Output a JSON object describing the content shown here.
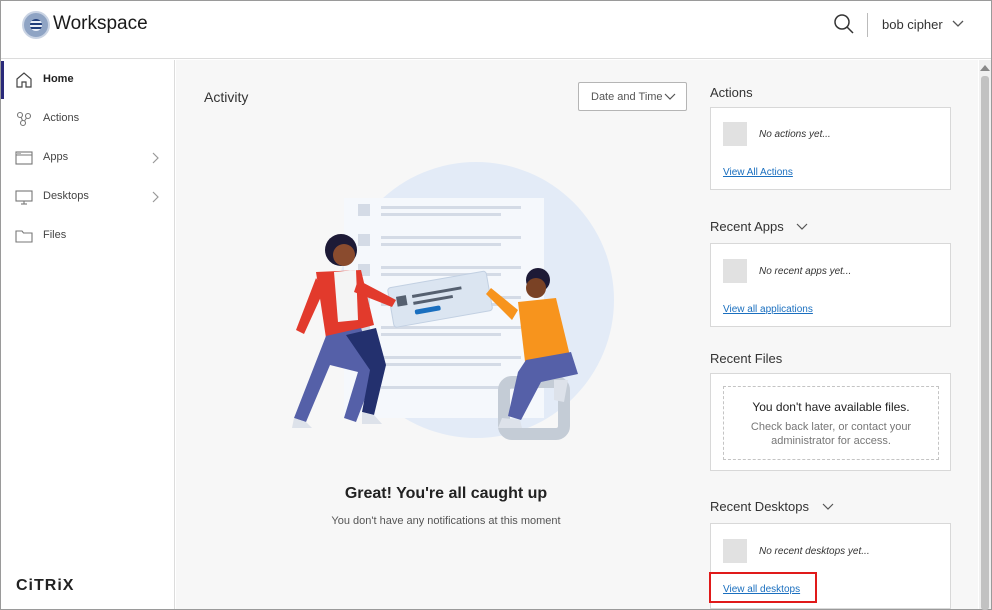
{
  "header": {
    "app_title": "Workspace",
    "search_icon": "search-icon",
    "user_name": "bob cipher"
  },
  "sidebar": {
    "items": [
      {
        "label": "Home",
        "icon": "home-icon",
        "active": true
      },
      {
        "label": "Actions",
        "icon": "actions-icon"
      },
      {
        "label": "Apps",
        "icon": "apps-icon",
        "has_submenu": true
      },
      {
        "label": "Desktops",
        "icon": "desktop-icon",
        "has_submenu": true
      },
      {
        "label": "Files",
        "icon": "folder-icon"
      }
    ],
    "brand": "CiTRiX"
  },
  "activity": {
    "title": "Activity",
    "filter_label": "Date and Time",
    "heading": "Great! You're all caught up",
    "subtext": "You don't have any notifications at this moment"
  },
  "actions_panel": {
    "title": "Actions",
    "empty_text": "No actions yet...",
    "link": "View All Actions"
  },
  "recent_apps": {
    "title": "Recent Apps",
    "empty_text": "No recent apps yet...",
    "link": "View all applications"
  },
  "recent_files": {
    "title": "Recent Files",
    "empty_title": "You don't have available files.",
    "empty_sub": "Check back later, or contact your administrator for access."
  },
  "recent_desktops": {
    "title": "Recent Desktops",
    "empty_text": "No recent desktops yet...",
    "link": "View all desktops"
  },
  "colors": {
    "accent_nav": "#2a2a7a",
    "link": "#1a6fbf",
    "highlight": "#e01a1a",
    "main_bg": "#f7f7f7"
  }
}
